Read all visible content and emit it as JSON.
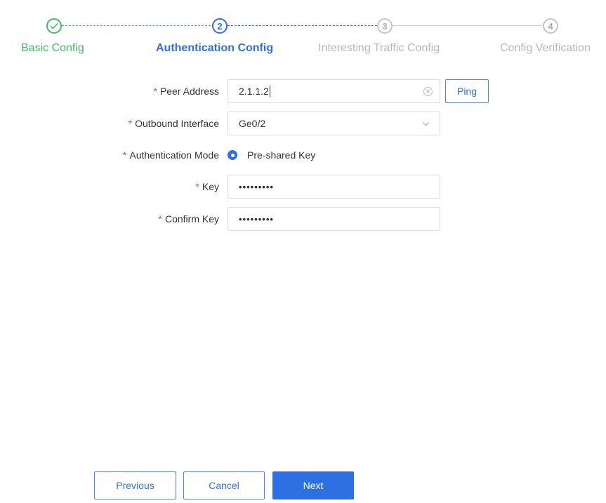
{
  "stepper": {
    "steps": [
      {
        "number": "",
        "title": "Basic Config",
        "status": "done",
        "icon": "check-icon"
      },
      {
        "number": "2",
        "title": "Authentication Config",
        "status": "active"
      },
      {
        "number": "3",
        "title": "Interesting Traffic Config",
        "status": "pending"
      },
      {
        "number": "4",
        "title": "Config Verification",
        "status": "pending"
      }
    ]
  },
  "form": {
    "required_mark": "*",
    "peer_address": {
      "label": "Peer Address",
      "value": "2.1.1.2",
      "ping_label": "Ping"
    },
    "outbound_interface": {
      "label": "Outbound Interface",
      "value": "Ge0/2"
    },
    "auth_mode": {
      "label": "Authentication Mode",
      "option": "Pre-shared Key",
      "selected": true
    },
    "key": {
      "label": "Key",
      "value": "•••••••••"
    },
    "confirm_key": {
      "label": "Confirm Key",
      "value": "•••••••••"
    }
  },
  "footer": {
    "previous_label": "Previous",
    "cancel_label": "Cancel",
    "next_label": "Next"
  },
  "colors": {
    "done": "#3fbf5f",
    "active": "#2f6fe4",
    "pending": "#b3b8c0",
    "required": "#e84545"
  }
}
